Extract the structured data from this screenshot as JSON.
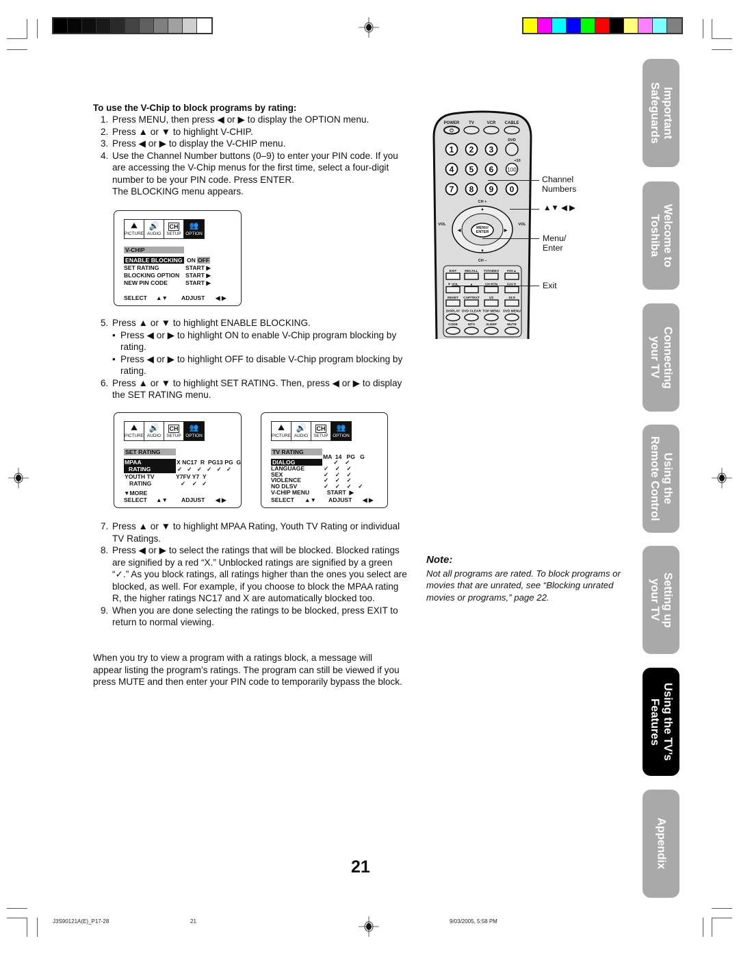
{
  "print_marks": {
    "gray_swatches": [
      "#000000",
      "#050505",
      "#0e0e0e",
      "#1a1a1a",
      "#2a2a2a",
      "#444444",
      "#5f5f5f",
      "#7f7f7f",
      "#a0a0a0",
      "#cfcfcf",
      "#ffffff"
    ],
    "color_swatches": [
      "#ffff00",
      "#ff00ff",
      "#00ffff",
      "#0000ff",
      "#00ff00",
      "#ff0000",
      "#000000",
      "#ffff80",
      "#ff80ff",
      "#80ffff",
      "#808080"
    ]
  },
  "instructions": {
    "heading": "To use the V-Chip to block programs by rating:",
    "steps_a": [
      {
        "num": "1.",
        "text": "Press MENU, then press ◀ or ▶ to display the OPTION menu."
      },
      {
        "num": "2.",
        "text": "Press ▲ or ▼ to highlight V-CHIP."
      },
      {
        "num": "3.",
        "text": "Press ◀ or ▶ to display the V-CHIP menu."
      },
      {
        "num": "4.",
        "text": "Use the Channel Number buttons (0–9) to enter your PIN code. If you are accessing the V-Chip menus for the first time, select a four-digit number to be your PIN code. Press ENTER.\nThe BLOCKING menu appears."
      }
    ],
    "step5": {
      "num": "5.",
      "text": "Press ▲ or ▼ to highlight ENABLE BLOCKING."
    },
    "step5_bullets": [
      "Press ◀ or ▶ to highlight ON to enable V-Chip program blocking by rating.",
      "Press ◀ or ▶ to highlight OFF to disable V-Chip program blocking by rating."
    ],
    "step6": {
      "num": "6.",
      "text": "Press ▲ or ▼ to highlight SET RATING. Then, press ◀ or ▶ to display the SET RATING menu."
    },
    "steps_c": [
      {
        "num": "7.",
        "text": "Press ▲ or ▼ to highlight MPAA Rating, Youth TV Rating or individual TV Ratings."
      },
      {
        "num": "8.",
        "text": "Press ◀ or ▶ to select the ratings that will be blocked. Blocked ratings are signified by a red “X.” Unblocked ratings are signified by a green “✓.” As you block ratings, all ratings higher than the ones you select are blocked, as well. For example, if you choose to block the MPAA rating R, the higher ratings NC17 and X are automatically blocked too."
      },
      {
        "num": "9.",
        "text": "When you are done selecting the ratings to be blocked, press EXIT to return to normal viewing."
      }
    ],
    "closing": "When you try to view a program with a ratings block, a message will appear listing the program’s ratings. The program can still be viewed if you press MUTE and then enter your PIN code to temporarily bypass the block."
  },
  "osd_tabs": [
    {
      "label": "PICTURE",
      "icon": "⛰"
    },
    {
      "label": "AUDIO",
      "icon": "🔊"
    },
    {
      "label": "SETUP",
      "icon": "CH"
    },
    {
      "label": "OPTION",
      "icon": "👥"
    }
  ],
  "osd_common": {
    "select": "SELECT",
    "updown": "▲▼",
    "adjust": "ADJUST",
    "leftright": "◀ ▶",
    "check": "✓",
    "arrow": "▶"
  },
  "vchip_menu": {
    "title": "V-CHIP",
    "rows": [
      {
        "label": "ENABLE BLOCKING",
        "value_on": "ON",
        "value_off": "OFF",
        "highlighted": true
      },
      {
        "label": "SET RATING",
        "value": "START ▶"
      },
      {
        "label": "BLOCKING OPTION",
        "value": "START ▶"
      },
      {
        "label": "NEW PIN CODE",
        "value": "START ▶"
      }
    ]
  },
  "set_rating_menu": {
    "title": "SET RATING",
    "mpaa_label_1": "MPAA",
    "mpaa_label_2": "RATING",
    "mpaa_headers": "X NC17  R  PG13 PG  G",
    "mpaa_checks": "✓   ✓   ✓   ✓   ✓   ✓",
    "youth_label_1": "YOUTH TV",
    "youth_label_2": "RATING",
    "youth_headers": "Y7FV Y7  Y",
    "youth_checks": "✓    ✓   ✓",
    "more": "▼MORE"
  },
  "tv_rating_menu": {
    "title": "TV RATING",
    "col_headers": "MA  14   PG   G",
    "rows": [
      {
        "label": "DIALOG",
        "checks": "      ✓    ✓",
        "highlighted": true
      },
      {
        "label": "LANGUAGE",
        "checks": "✓    ✓    ✓"
      },
      {
        "label": "SEX",
        "checks": "✓    ✓    ✓"
      },
      {
        "label": "VIOLENCE",
        "checks": "✓    ✓    ✓"
      },
      {
        "label": "NO DLSV",
        "checks": "✓    ✓    ✓    ✓"
      },
      {
        "label": "V-CHIP MENU",
        "checks": "  START  ▶"
      }
    ]
  },
  "remote": {
    "top_labels": [
      "POWER",
      "TV",
      "VCR",
      "CABLE"
    ],
    "dvd": "DVD",
    "plus10": "+10",
    "digits": [
      "1",
      "2",
      "3",
      "4",
      "5",
      "6",
      "7",
      "8",
      "9",
      "0"
    ],
    "hundred": "100",
    "ch_plus": "CH +",
    "ch_minus": "CH –",
    "vol": "VOL",
    "menu_enter": "MENU/ ENTER",
    "lower_rows": [
      [
        "EXIT",
        "RECALL",
        "TV/VIDEO",
        "FAV▲"
      ],
      [
        "▼  VOL",
        "▲",
        "CH RTN",
        "FAV▼"
      ],
      [
        "RESET",
        "CAP/TEXT",
        "1/2",
        "16:9"
      ],
      [
        "DISPLAY",
        "DVD CLEAR",
        "TOP MENU",
        "DVD MENU"
      ],
      [
        "CODE",
        "MTS",
        "SLEEP",
        "MUTE"
      ]
    ],
    "callouts": {
      "channel_numbers": "Channel\nNumbers",
      "arrows": "▲▼ ◀ ▶",
      "menu_enter": "Menu/\nEnter",
      "exit": "Exit"
    }
  },
  "note": {
    "heading": "Note:",
    "text": "Not all programs are rated. To block programs or movies that are unrated, see “Blocking unrated movies or programs,” page 22."
  },
  "side_tabs": [
    {
      "label": "Important\nSafeguards",
      "active": false
    },
    {
      "label": "Welcome to\nToshiba",
      "active": false
    },
    {
      "label": "Connecting\nyour TV",
      "active": false
    },
    {
      "label": "Using the\nRemote Control",
      "active": false
    },
    {
      "label": "Setting up\nyour TV",
      "active": false
    },
    {
      "label": "Using the TV’s\nFeatures",
      "active": true
    },
    {
      "label": "Appendix",
      "active": false
    }
  ],
  "page_number": "21",
  "footer": {
    "doc_id": "J3S90121A(E)_P17-28",
    "page": "21",
    "date": "9/03/2005, 5:58 PM"
  }
}
